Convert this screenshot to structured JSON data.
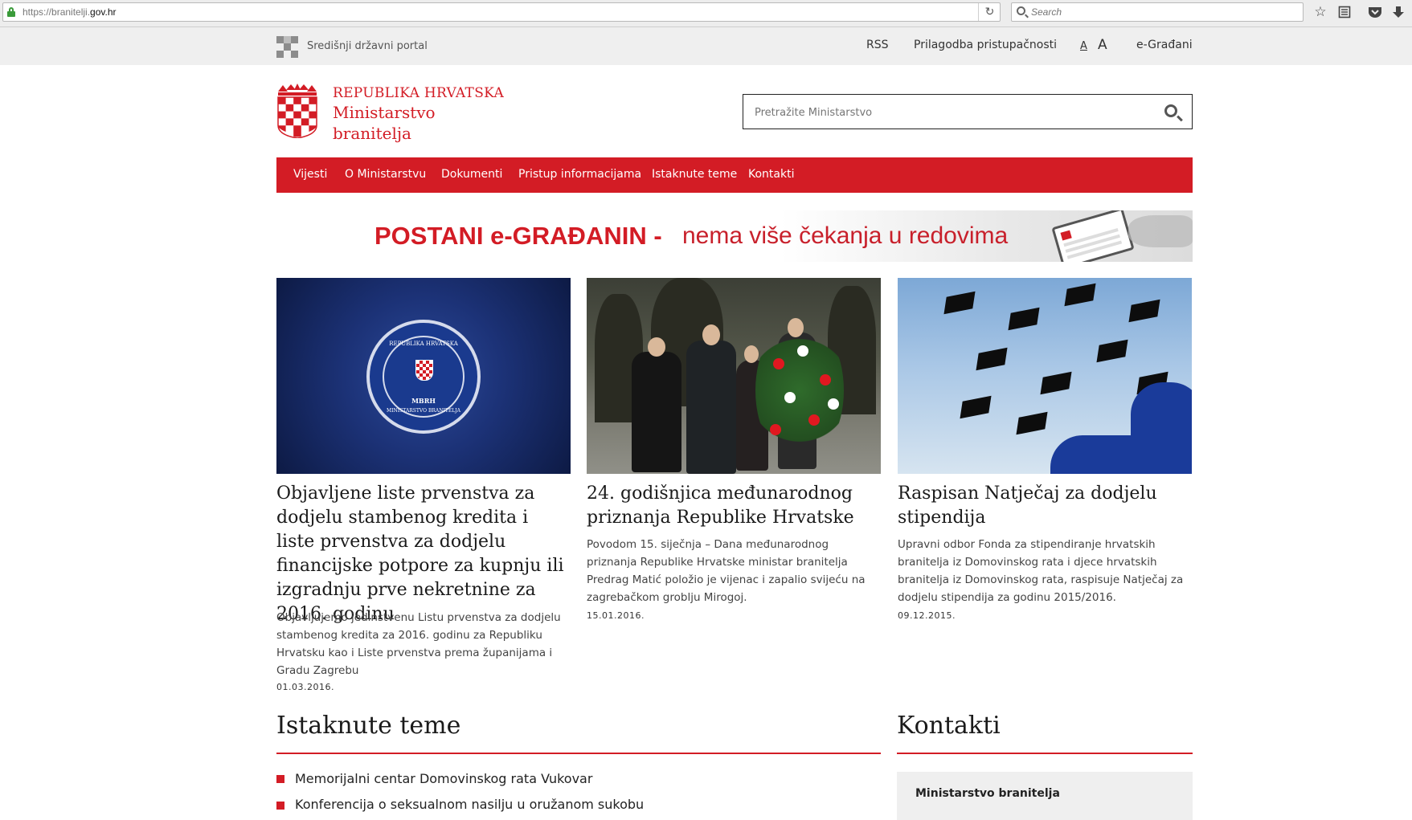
{
  "browser": {
    "url_prefix": "https://branitelji.",
    "url_domain": "gov.hr",
    "reload_glyph": "↻",
    "search_placeholder": "Search",
    "icons": [
      "star-icon",
      "reading-list-icon",
      "pocket-icon",
      "download-icon"
    ]
  },
  "portal": {
    "label": "Središnji državni portal",
    "links": {
      "rss": "RSS",
      "accessibility": "Prilagodba pristupačnosti",
      "font_small": "A",
      "font_big": "A",
      "e_citizens": "e-Građani"
    }
  },
  "header": {
    "line1": "REPUBLIKA HRVATSKA",
    "line2": "Ministarstvo",
    "line3": "branitelja",
    "search_placeholder": "Pretražite Ministarstvo"
  },
  "nav": [
    "Vijesti",
    "O Ministarstvu",
    "Dokumenti",
    "Pristup informacijama",
    "Istaknute teme",
    "Kontakti"
  ],
  "banner": {
    "strong": "POSTANI e-GRAĐANIN -",
    "soft": "nema više čekanja u redovima"
  },
  "seal": {
    "top": "REPUBLIKA HRVATSKA",
    "mid": "MBRH",
    "bottom": "MINISTARSTVO BRANITELJA"
  },
  "news": [
    {
      "title": "Objavljene liste prvenstva za dodjelu stambenog kredita i liste prvenstva za dodjelu financijske potpore za kupnju ili izgradnju prve nekretnine za 2016. godinu",
      "text": "Objavljujemo jedinstvenu Listu prvenstva za dodjelu stambenog kredita za 2016. godinu za Republiku Hrvatsku kao i Liste prvenstva prema županijama i Gradu Zagrebu",
      "date": "01.03.2016."
    },
    {
      "title": "24. godišnjica međunarodnog priznanja Republike Hrvatske",
      "text": "Povodom 15. siječnja – Dana međunarodnog priznanja Republike Hrvatske ministar branitelja Predrag Matić položio je vijenac i zapalio svijeću na zagrebačkom groblju Mirogoj.",
      "date": "15.01.2016."
    },
    {
      "title": "Raspisan Natječaj za dodjelu stipendija",
      "text": "Upravni odbor Fonda za stipendiranje hrvatskih branitelja iz Domovinskog rata i djece hrvatskih branitelja iz Domovinskog rata, raspisuje Natječaj za dodjelu stipendija za godinu 2015/2016.",
      "date": "09.12.2015."
    }
  ],
  "featured": {
    "title": "Istaknute teme",
    "items": [
      "Memorijalni centar Domovinskog rata Vukovar",
      "Konferencija o seksualnom nasilju u oružanom sukobu"
    ]
  },
  "contacts": {
    "title": "Kontakti",
    "name": "Ministarstvo branitelja"
  },
  "colors": {
    "brand_red": "#d31c25",
    "portal_gray": "#efefef"
  }
}
